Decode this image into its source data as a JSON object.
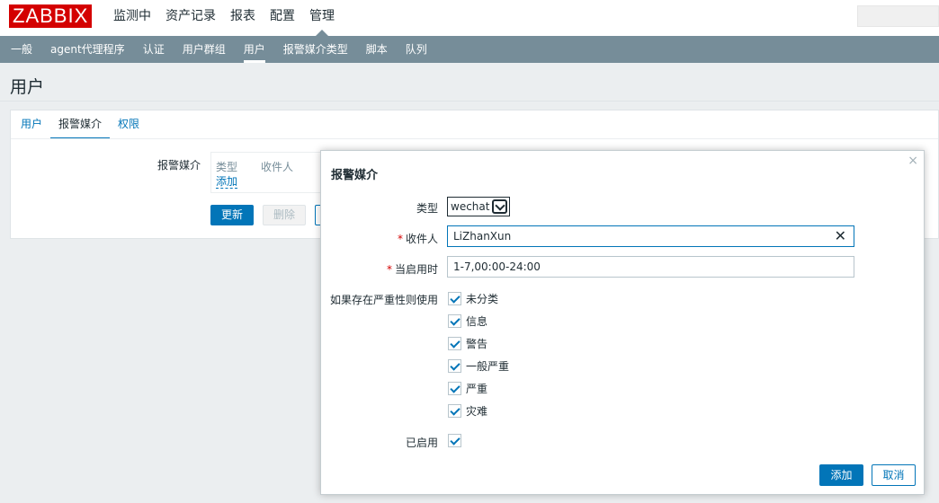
{
  "header": {
    "logo": "ZABBIX",
    "main_menu": [
      "监测中",
      "资产记录",
      "报表",
      "配置",
      "管理"
    ],
    "sub_menu": [
      "一般",
      "agent代理程序",
      "认证",
      "用户群组",
      "用户",
      "报警媒介类型",
      "脚本",
      "队列"
    ],
    "page_title": "用户"
  },
  "form": {
    "tabs": [
      "用户",
      "报警媒介",
      "权限"
    ],
    "media_label": "报警媒介",
    "media_headers": [
      "类型",
      "收件人"
    ],
    "add_link": "添加",
    "update_button": "更新",
    "delete_button": "删除"
  },
  "dialog": {
    "title": "报警媒介",
    "close_icon": "×",
    "type_label": "类型",
    "type_value": "wechat",
    "sendto_label": "收件人",
    "sendto_value": "LiZhanXun",
    "clear_icon": "✕",
    "period_label": "当启用时",
    "period_value": "1-7,00:00-24:00",
    "severity_label": "如果存在严重性则使用",
    "severities": [
      "未分类",
      "信息",
      "警告",
      "一般严重",
      "严重",
      "灾难"
    ],
    "enabled_label": "已启用",
    "add_button": "添加",
    "cancel_button": "取消",
    "required_mark": "*"
  },
  "colors": {
    "brand_red": "#d40000",
    "submenu_bg": "#768d99",
    "primary_blue": "#0275b8"
  }
}
